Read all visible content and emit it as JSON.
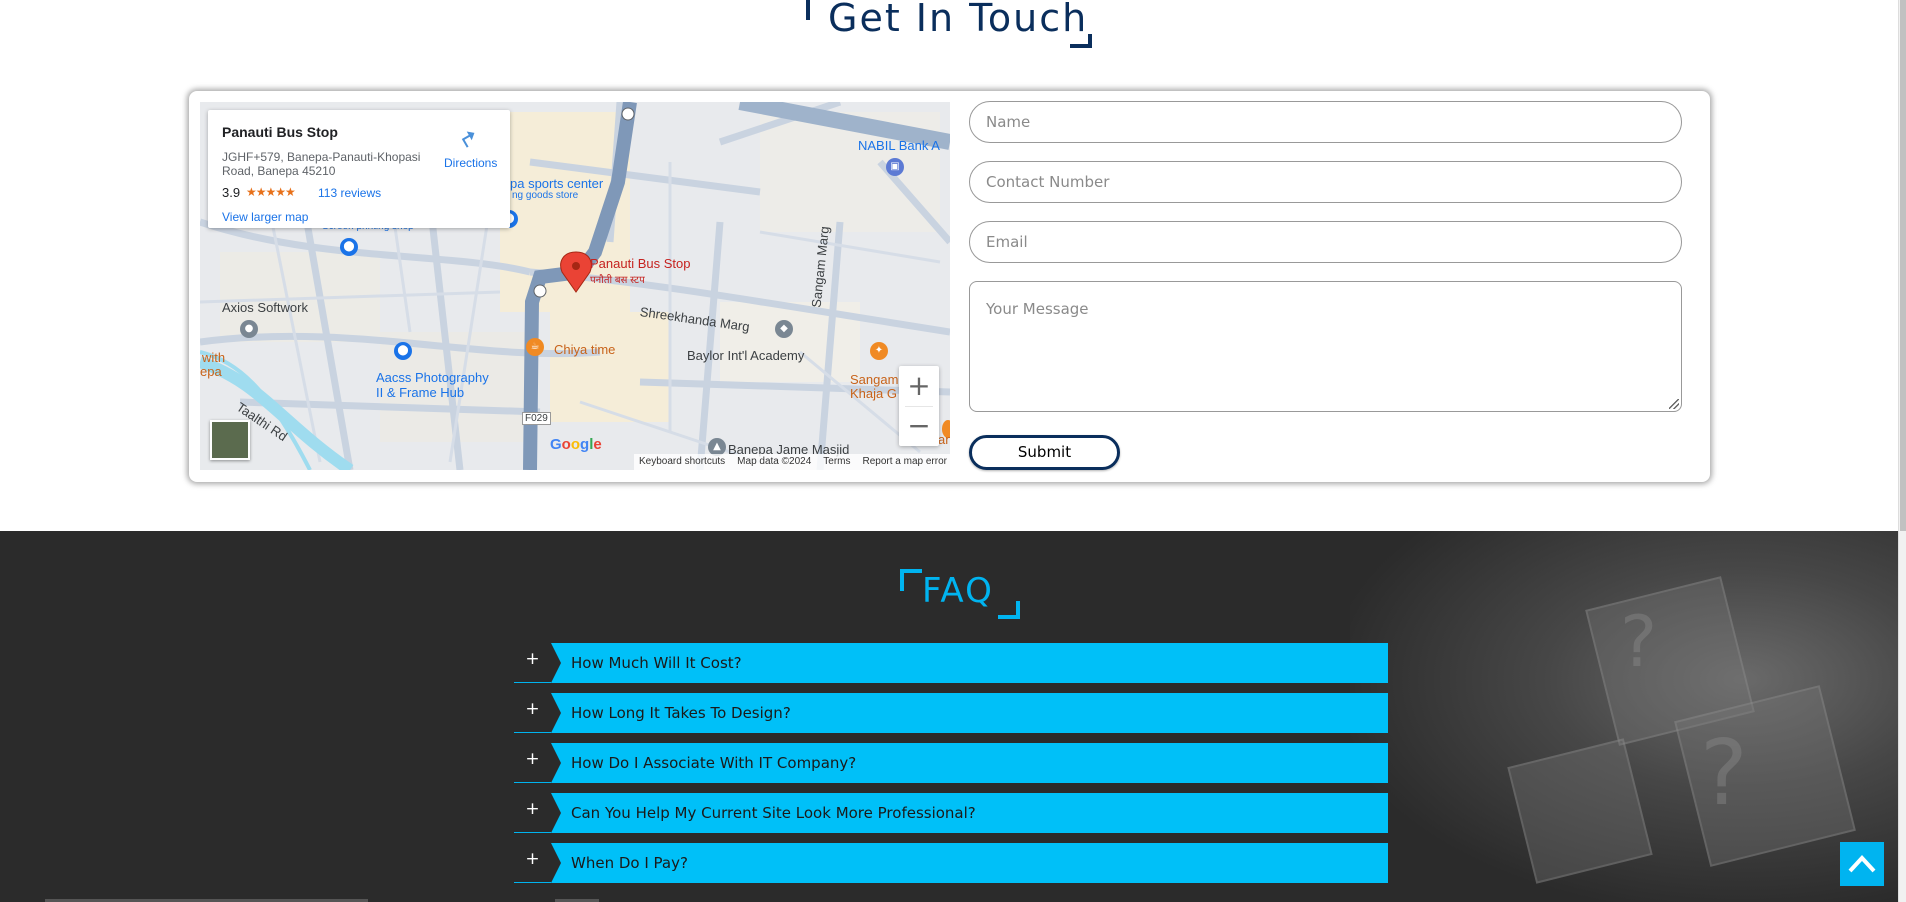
{
  "contact": {
    "title": "Get In Touch",
    "map": {
      "place_name": "Panauti Bus Stop",
      "address": "JGHF+579, Banepa-Panauti-Khopasi Road, Banepa 45210",
      "rating": "3.9",
      "stars": "★★★★★",
      "reviews": "113 reviews",
      "view_larger": "View larger map",
      "directions": "Directions",
      "labels": {
        "pin_name": "Panauti Bus Stop",
        "pin_name_local": "पनौती बस स्टप",
        "sports": "pa sports center",
        "sports2": "ng goods store",
        "screen": "Screen printing shop",
        "nabil": "NABIL Bank A",
        "axios": "Axios Softwork",
        "aacss1": "Aacss Photography",
        "aacss2": "II & Frame Hub",
        "chiya": "Chiya time",
        "shree": "Shreekhanda Marg",
        "baylor": "Baylor Int'l Academy",
        "sangam": "Sangam Marg",
        "sangam2": "Sangam",
        "khaja": "Khaja G",
        "taal": "Taalthi Rd",
        "with": "with",
        "epa": "epa",
        "f029": "F029",
        "masjid": "Banepa Jame Masjid",
        "an": "an"
      },
      "zoom_in": "+",
      "zoom_out": "−",
      "google": [
        "G",
        "o",
        "o",
        "g",
        "l",
        "e"
      ],
      "footer": {
        "shortcuts": "Keyboard shortcuts",
        "data": "Map data ©2024",
        "terms": "Terms",
        "report": "Report a map error"
      }
    },
    "form": {
      "name_placeholder": "Name",
      "contact_placeholder": "Contact Number",
      "email_placeholder": "Email",
      "message_placeholder": "Your Message",
      "submit_label": "Submit"
    }
  },
  "faq": {
    "title": "FAQ",
    "items": [
      {
        "icon": "+",
        "question": "How Much Will It Cost?"
      },
      {
        "icon": "+",
        "question": "How Long It Takes To Design?"
      },
      {
        "icon": "+",
        "question": "How Do I Associate With IT Company?"
      },
      {
        "icon": "+",
        "question": "Can You Help My Current Site Look More Professional?"
      },
      {
        "icon": "+",
        "question": "When Do I Pay?"
      }
    ]
  },
  "colors": {
    "navy": "#0a2e5c",
    "accent": "#00b4f0",
    "faq_bar": "#00c0f8",
    "faq_bg": "#2b2b2b"
  },
  "icons": {
    "back_to_top": "chevron-up-icon"
  }
}
